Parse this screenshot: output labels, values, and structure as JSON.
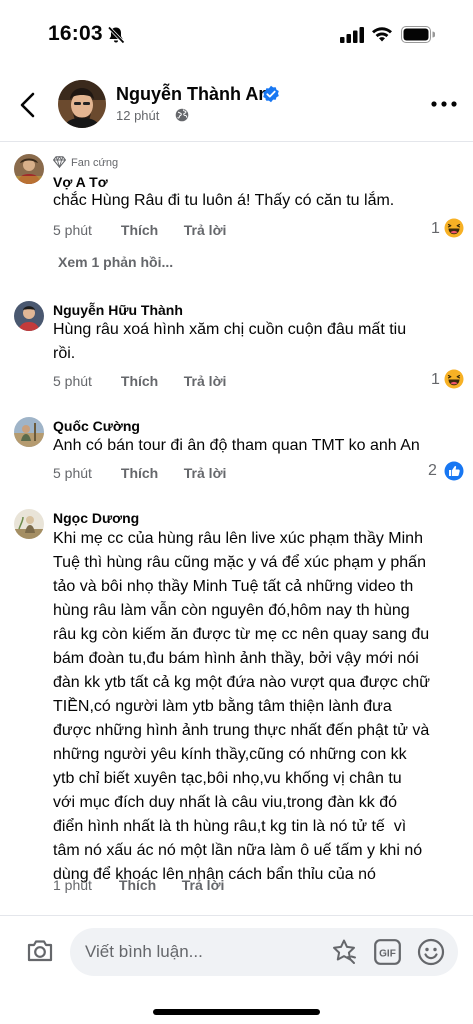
{
  "status_bar": {
    "time": "16:03"
  },
  "header": {
    "name": "Nguyễn Thành An",
    "time": "12 phút"
  },
  "comments": [
    {
      "badge": "Fan cứng",
      "name": "Vợ A Tơ",
      "text": "chắc Hùng Râu đi tu luôn á! Thấy có căn tu lắm.",
      "time": "5 phút",
      "like": "Thích",
      "reply": "Trả lời",
      "reaction_count": "1",
      "reaction": "haha-icon",
      "view_replies": "Xem 1 phản hồi..."
    },
    {
      "name": "Nguyễn Hữu Thành",
      "text": "Hùng râu xoá hình xăm chị cuồn cuộn đâu mất tiu\nrồi.",
      "time": "5 phút",
      "like": "Thích",
      "reply": "Trả lời",
      "reaction_count": "1",
      "reaction": "haha-icon"
    },
    {
      "name": "Quốc Cường",
      "text": "Anh có bán tour đi ân độ tham quan TMT ko anh An",
      "time": "5 phút",
      "like": "Thích",
      "reply": "Trả lời",
      "reaction_count": "2",
      "reaction": "like-icon"
    },
    {
      "name": "Ngọc Dương",
      "text": "Khi mẹ cc của hùng râu lên live xúc phạm thầy Minh\nTuệ thì hùng râu cũng mặc y vá để xúc phạm y phấn\ntảo và bôi nhọ thầy Minh Tuệ tất cả những video th\nhùng râu làm vẫn còn nguyên đó,hôm nay th hùng\nrâu kg còn kiếm ăn được từ mẹ cc nên quay sang đu\nbám đoàn tu,đu bám hình ảnh thầy, bởi vậy mới nói\nđàn kk ytb tất cả kg một đứa nào vượt qua được chữ\nTIỀN,có người làm ytb bằng tâm thiện lành đưa\nđược những hình ảnh trung thực nhất đến phật tử và\nnhững người yêu kính thầy,cũng có những con kk\nytb chỉ biết xuyên tạc,bôi nhọ,vu khống vị chân tu\nvới mục đích duy nhất là câu viu,trong đàn kk đó\nđiển hình nhất là th hùng râu,t kg tin là nó tử tế  vì\ntâm nó xấu ác nó một lần nữa làm ô uế tấm y khi nó\ndùng để khoác lên nhân cách bẩn thỉu của nó",
      "time": "1 phút",
      "like": "Thích",
      "reply": "Trả lời"
    }
  ],
  "composer": {
    "placeholder": "Viết bình luận..."
  },
  "colors": {
    "verified": "#1877f2",
    "meta": "#65676b",
    "like_blue": "#1877f2",
    "haha_yellow": "#f7b125"
  }
}
